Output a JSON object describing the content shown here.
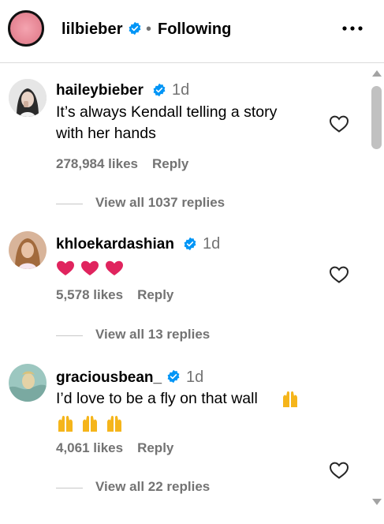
{
  "header": {
    "username": "lilbieber",
    "separator": "•",
    "follow_status": "Following",
    "more_icon": "more-horizontal-icon"
  },
  "comments": [
    {
      "username": "haileybieber",
      "verified": true,
      "time": "1d",
      "text_lines": [
        "It’s always Kendall telling a story",
        "with her hands"
      ],
      "likes": "278,984 likes",
      "reply": "Reply",
      "view_replies": "View all 1037 replies"
    },
    {
      "username": "khloekardashian",
      "verified": true,
      "time": "1d",
      "emoji": [
        "heart",
        "heart",
        "heart"
      ],
      "likes": "5,578 likes",
      "reply": "Reply",
      "view_replies": "View all 13 replies"
    },
    {
      "username": "graciousbean_",
      "verified": true,
      "time": "1d",
      "text_lines": [
        "I’d love to be a fly on that wall"
      ],
      "emoji": [
        "raising-hands",
        "raising-hands",
        "raising-hands",
        "raising-hands"
      ],
      "likes": "4,061 likes",
      "reply": "Reply",
      "view_replies": "View all 22 replies"
    }
  ],
  "colors": {
    "verified_blue": "#0095f6",
    "secondary_text": "#737373",
    "heart_red": "#e0245e"
  }
}
